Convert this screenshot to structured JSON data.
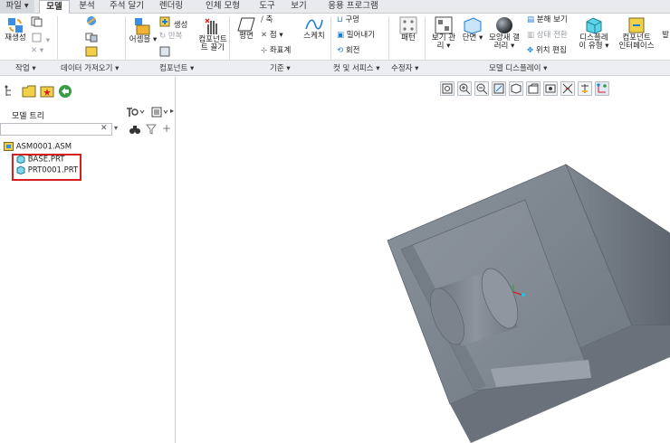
{
  "tabs": [
    {
      "label": "파일",
      "type": "file"
    },
    {
      "label": "모델",
      "type": "active"
    },
    {
      "label": "분석",
      "type": ""
    },
    {
      "label": "주석 달기",
      "type": ""
    },
    {
      "label": "렌더링",
      "type": ""
    },
    {
      "label": "인체 모형",
      "type": ""
    },
    {
      "label": "도구",
      "type": ""
    },
    {
      "label": "보기",
      "type": ""
    },
    {
      "label": "응용 프로그램",
      "type": ""
    }
  ],
  "ribbon": {
    "regenerate": "재생성",
    "assemble": "어셈블",
    "create": "생성",
    "repeat": "반복",
    "drag_components_1": "컴포넌트",
    "drag_components_2": "트 끌기",
    "plane": "평면",
    "axis": "축",
    "point": "점",
    "csys": "좌표계",
    "sketch": "스케치",
    "hole": "구멍",
    "extrude": "밀어내기",
    "revolve": "회전",
    "pattern": "패턴",
    "manage_views_1": "보기 관",
    "manage_views_2": "리",
    "section": "단면",
    "appearance_1": "모양새 갤",
    "appearance_2": "러리",
    "explode_view": "분해 보기",
    "toggle_status": "상태 전환",
    "edit_position": "위치 편집",
    "display_style_1": "디스플레",
    "display_style_2": "이 유형",
    "component_interface_1": "컴포넌트",
    "component_interface_2": "인터페이스",
    "more": "발"
  },
  "groups": [
    "작업",
    "데이터 가져오기",
    "컴포넌트",
    "기준",
    "컷 및 서피스",
    "수정자",
    "모델 디스플레이"
  ],
  "model_tree": {
    "title": "모델 트리",
    "root": "ASM0001.ASM",
    "children": [
      "BASE.PRT",
      "PRT0001.PRT"
    ]
  },
  "colors": {
    "highlight_box": "#d81e1e",
    "part_body": "#7d8590",
    "accent_blue": "#1c7ed6"
  }
}
